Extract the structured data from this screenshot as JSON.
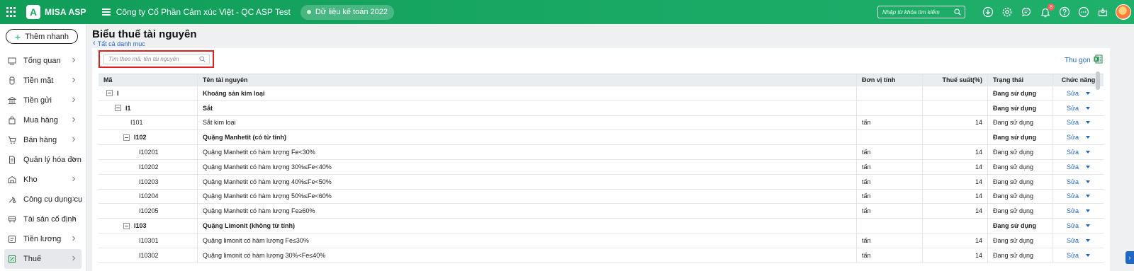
{
  "topbar": {
    "app_name": "MISA ASP",
    "company": "Công ty Cổ Phần Cảm xúc Việt - QC ASP Test",
    "data_year_label": "Dữ liệu kế toán 2022",
    "search_placeholder": "Nhập từ khóa tìm kiếm",
    "notification_count": "8",
    "icons": [
      "download-icon",
      "settings-icon",
      "chat-icon",
      "bell-icon",
      "help-icon",
      "more-icon",
      "inbox-icon",
      "avatar"
    ],
    "brand_color": "#1aa865"
  },
  "sidebar": {
    "add_button": "Thêm nhanh",
    "items": [
      {
        "label": "Tổng quan",
        "icon": "dashboard-icon"
      },
      {
        "label": "Tiền mặt",
        "icon": "cash-icon"
      },
      {
        "label": "Tiền gửi",
        "icon": "bank-icon"
      },
      {
        "label": "Mua hàng",
        "icon": "shopping-bag-icon"
      },
      {
        "label": "Bán hàng",
        "icon": "cart-icon"
      },
      {
        "label": "Quản lý hóa đơn",
        "icon": "invoice-icon"
      },
      {
        "label": "Kho",
        "icon": "warehouse-icon"
      },
      {
        "label": "Công cụ dụng cụ",
        "icon": "tools-icon"
      },
      {
        "label": "Tài sản cố định",
        "icon": "asset-icon"
      },
      {
        "label": "Tiền lương",
        "icon": "salary-icon"
      },
      {
        "label": "Thuế",
        "icon": "tax-icon",
        "active": true
      }
    ]
  },
  "page": {
    "title": "Biểu thuế tài nguyên",
    "back_link": "Tất cả danh mục",
    "search_placeholder": "Tìm theo mã, tên tài nguyên",
    "collapse_label": "Thu gọn"
  },
  "table": {
    "headers": [
      "Mã",
      "Tên tài nguyên",
      "Đơn vị tính",
      "Thuế suất(%)",
      "Trạng thái",
      "Chức năng"
    ],
    "edit_label": "Sửa",
    "rows": [
      {
        "code": "I",
        "name": "Khoáng sản kim loại",
        "unit": "",
        "rate": "",
        "status": "Đang sử dụng",
        "level": 0,
        "group": true
      },
      {
        "code": "I1",
        "name": "Sắt",
        "unit": "",
        "rate": "",
        "status": "Đang sử dụng",
        "level": 1,
        "group": true
      },
      {
        "code": "I101",
        "name": "Sắt kim loại",
        "unit": "tấn",
        "rate": "14",
        "status": "Đang sử dụng",
        "level": 2,
        "group": false
      },
      {
        "code": "I102",
        "name": "Quặng Manhetit (có từ tính)",
        "unit": "",
        "rate": "",
        "status": "Đang sử dụng",
        "level": 2,
        "group": true
      },
      {
        "code": "I10201",
        "name": "Quặng Manhetit có hàm lượng Fe<30%",
        "unit": "tấn",
        "rate": "14",
        "status": "Đang sử dụng",
        "level": 3,
        "group": false
      },
      {
        "code": "I10202",
        "name": "Quặng Manhetit có hàm lượng 30%≤Fe<40%",
        "unit": "tấn",
        "rate": "14",
        "status": "Đang sử dụng",
        "level": 3,
        "group": false
      },
      {
        "code": "I10203",
        "name": "Quặng Manhetit có hàm lượng 40%≤Fe<50%",
        "unit": "tấn",
        "rate": "14",
        "status": "Đang sử dụng",
        "level": 3,
        "group": false
      },
      {
        "code": "I10204",
        "name": "Quặng Manhetit có hàm lượng 50%≤Fe<60%",
        "unit": "tấn",
        "rate": "14",
        "status": "Đang sử dụng",
        "level": 3,
        "group": false
      },
      {
        "code": "I10205",
        "name": "Quặng Manhetit có hàm lượng Fe≥60%",
        "unit": "tấn",
        "rate": "14",
        "status": "Đang sử dụng",
        "level": 3,
        "group": false
      },
      {
        "code": "I103",
        "name": "Quặng Limonit (không từ tính)",
        "unit": "",
        "rate": "",
        "status": "Đang sử dụng",
        "level": 2,
        "group": true
      },
      {
        "code": "I10301",
        "name": " Quặng limonit có hàm lượng  Fe≤30%",
        "unit": "tấn",
        "rate": "14",
        "status": "Đang sử dụng",
        "level": 3,
        "group": false
      },
      {
        "code": "I10302",
        "name": " Quặng limonit có hàm lượng 30%<Fe≤40%",
        "unit": "tấn",
        "rate": "14",
        "status": "Đang sử dụng",
        "level": 3,
        "group": false
      }
    ]
  }
}
